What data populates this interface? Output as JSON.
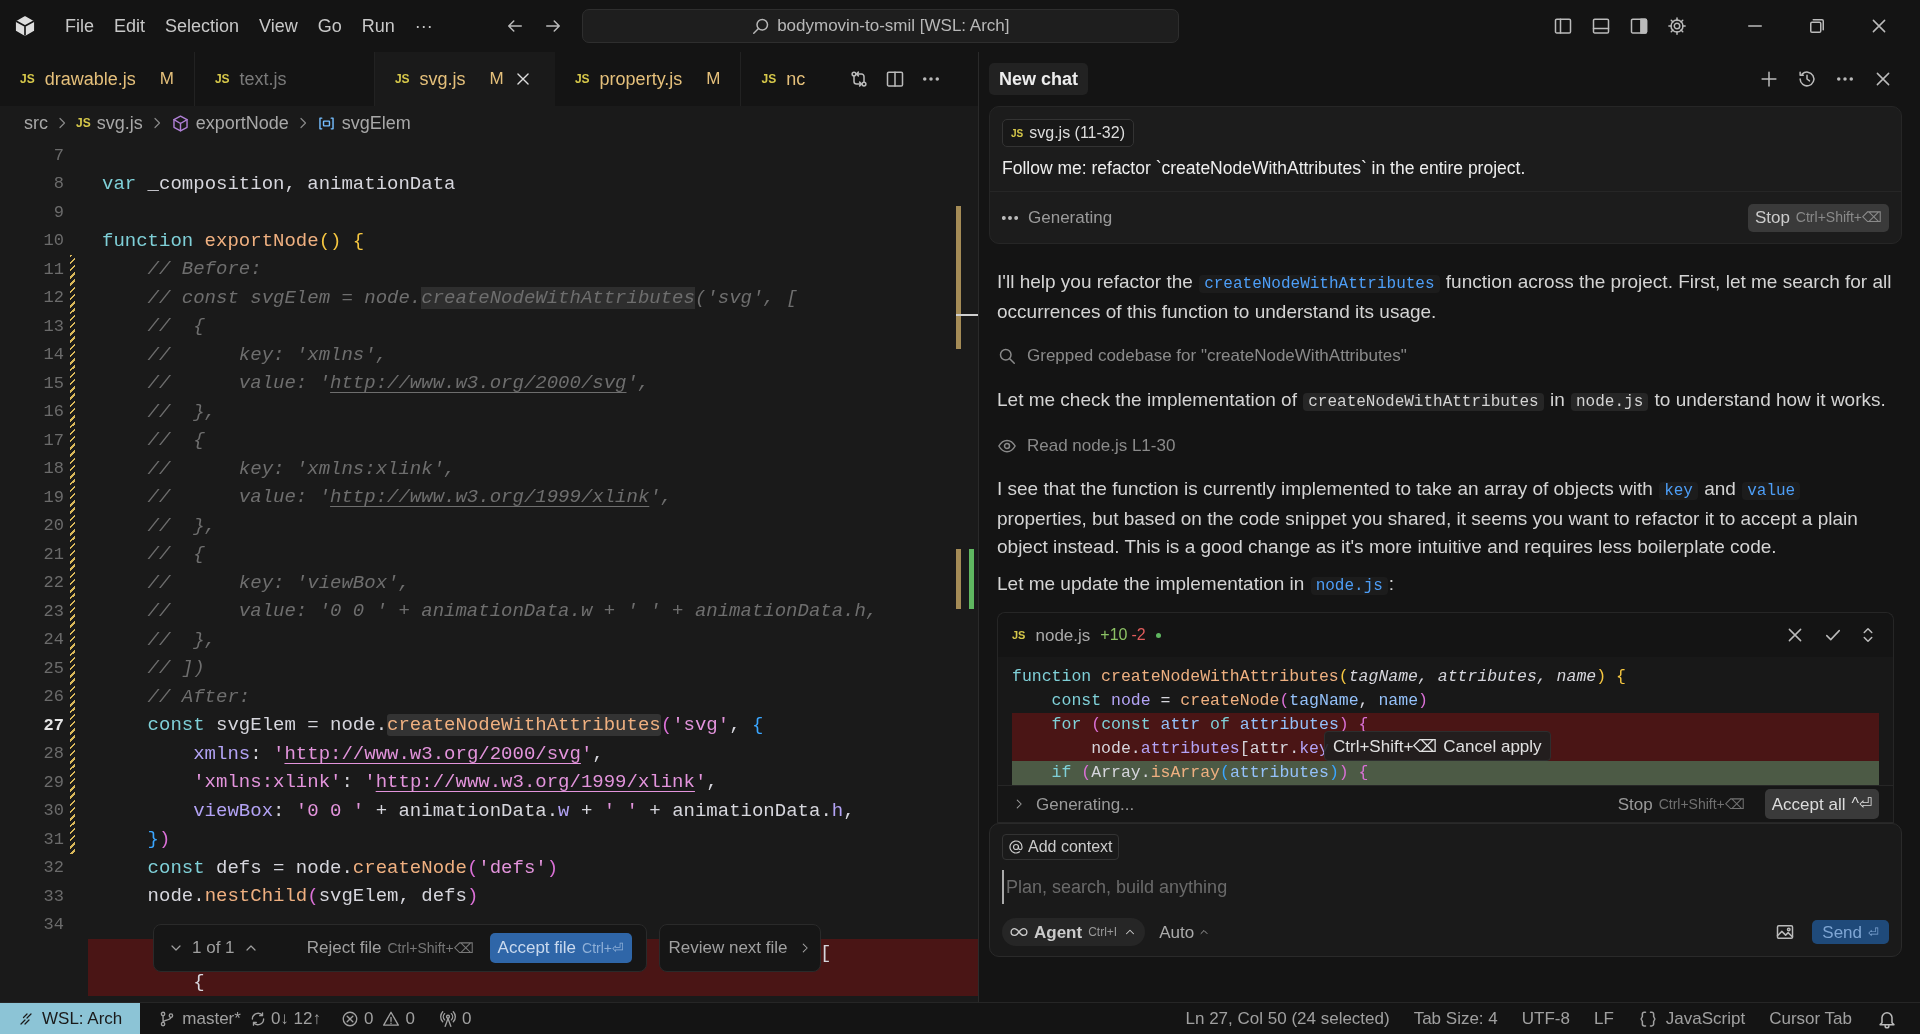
{
  "title_bar": {
    "menu": [
      "File",
      "Edit",
      "Selection",
      "View",
      "Go",
      "Run",
      "···"
    ],
    "search": "bodymovin-to-smil [WSL: Arch]"
  },
  "editor_tabs": [
    {
      "file_icon": "JS",
      "label": "drawable.js",
      "badge": "M",
      "kind": "modified",
      "selected": false
    },
    {
      "file_icon": "JS",
      "label": "text.js",
      "kind": "preview",
      "selected": false
    },
    {
      "file_icon": "JS",
      "label": "svg.js",
      "badge": "M",
      "kind": "modified",
      "selected": true
    },
    {
      "file_icon": "JS",
      "label": "property.js",
      "badge": "M",
      "kind": "modified",
      "selected": false
    },
    {
      "file_icon": "JS",
      "label": "nc",
      "kind": "modified",
      "selected": false
    }
  ],
  "breadcrumb": [
    {
      "kind": "folder",
      "label": "src"
    },
    {
      "kind": "file",
      "file_icon": "JS",
      "label": "svg.js"
    },
    {
      "kind": "method",
      "label": "exportNode"
    },
    {
      "kind": "variable",
      "label": "svgElem"
    }
  ],
  "code": [
    {
      "kind": "line",
      "n": "7",
      "changed": false,
      "current": false
    },
    {
      "kind": "line",
      "n": "8",
      "changed": false,
      "current": false,
      "tokens": [
        {
          "t": "var",
          "kind": "kw"
        },
        {
          "t": " _composition, animationData",
          "kind": "plain"
        }
      ]
    },
    {
      "kind": "line",
      "n": "9",
      "changed": false,
      "current": false
    },
    {
      "kind": "line",
      "n": "10",
      "changed": false,
      "current": false,
      "tokens": [
        {
          "t": "function",
          "kind": "kw"
        },
        {
          "t": " exportNode",
          "kind": "fn"
        },
        {
          "t": "()",
          "kind": "b1"
        },
        {
          "t": " {",
          "kind": "b1"
        }
      ]
    },
    {
      "kind": "line",
      "n": "11",
      "changed": true,
      "current": false,
      "tokens": [
        {
          "t": "    // Before:",
          "kind": "cmt"
        }
      ]
    },
    {
      "kind": "line",
      "n": "12",
      "changed": true,
      "current": false,
      "tokens": [
        {
          "t": "    // const svgElem = node.",
          "kind": "cmt"
        },
        {
          "t": "createNodeWithAttributes",
          "kind": "cmt-hl"
        },
        {
          "t": "('svg', [",
          "kind": "cmt"
        }
      ]
    },
    {
      "kind": "line",
      "n": "13",
      "changed": true,
      "current": false,
      "tokens": [
        {
          "t": "    //  {",
          "kind": "cmt"
        }
      ]
    },
    {
      "kind": "line",
      "n": "14",
      "changed": true,
      "current": false,
      "tokens": [
        {
          "t": "    //      key: 'xmlns',",
          "kind": "cmt"
        }
      ]
    },
    {
      "kind": "line",
      "n": "15",
      "changed": true,
      "current": false,
      "tokens": [
        {
          "t": "    //      value: '",
          "kind": "cmt"
        },
        {
          "t": "http://www.w3.org/2000/svg",
          "kind": "cmt-url"
        },
        {
          "t": "',",
          "kind": "cmt"
        }
      ]
    },
    {
      "kind": "line",
      "n": "16",
      "changed": true,
      "current": false,
      "tokens": [
        {
          "t": "    //  },",
          "kind": "cmt"
        }
      ]
    },
    {
      "kind": "line",
      "n": "17",
      "changed": true,
      "current": false,
      "tokens": [
        {
          "t": "    //  {",
          "kind": "cmt"
        }
      ]
    },
    {
      "kind": "line",
      "n": "18",
      "changed": true,
      "current": false,
      "tokens": [
        {
          "t": "    //      key: 'xmlns:xlink',",
          "kind": "cmt"
        }
      ]
    },
    {
      "kind": "line",
      "n": "19",
      "changed": true,
      "current": false,
      "tokens": [
        {
          "t": "    //      value: '",
          "kind": "cmt"
        },
        {
          "t": "http://www.w3.org/1999/xlink",
          "kind": "cmt-url"
        },
        {
          "t": "',",
          "kind": "cmt"
        }
      ]
    },
    {
      "kind": "line",
      "n": "20",
      "changed": true,
      "current": false,
      "tokens": [
        {
          "t": "    //  },",
          "kind": "cmt"
        }
      ]
    },
    {
      "kind": "line",
      "n": "21",
      "changed": true,
      "current": false,
      "tokens": [
        {
          "t": "    //  {",
          "kind": "cmt"
        }
      ]
    },
    {
      "kind": "line",
      "n": "22",
      "changed": true,
      "current": false,
      "tokens": [
        {
          "t": "    //      key: 'viewBox',",
          "kind": "cmt"
        }
      ]
    },
    {
      "kind": "line",
      "n": "23",
      "changed": true,
      "current": false,
      "tokens": [
        {
          "t": "    //      value: '0 0 ' + animationData.w + ' ' + animationData.h,",
          "kind": "cmt"
        }
      ]
    },
    {
      "kind": "line",
      "n": "24",
      "changed": true,
      "current": false,
      "tokens": [
        {
          "t": "    //  },",
          "kind": "cmt"
        }
      ]
    },
    {
      "kind": "line",
      "n": "25",
      "changed": true,
      "current": false,
      "tokens": [
        {
          "t": "    // ])",
          "kind": "cmt"
        }
      ]
    },
    {
      "kind": "line",
      "n": "26",
      "changed": true,
      "current": false,
      "tokens": [
        {
          "t": "    // After:",
          "kind": "cmt"
        }
      ]
    },
    {
      "kind": "line",
      "n": "27",
      "changed": true,
      "current": true,
      "tokens": [
        {
          "t": "    const",
          "kind": "kw"
        },
        {
          "t": " svgElem = node.",
          "kind": "plain"
        },
        {
          "t": "createNodeWithAttributes",
          "kind": "fn-hl"
        },
        {
          "t": "(",
          "kind": "b2"
        },
        {
          "t": "'svg'",
          "kind": "str"
        },
        {
          "t": ",",
          "kind": "plain"
        },
        {
          "t": " {",
          "kind": "b3"
        }
      ]
    },
    {
      "kind": "line",
      "n": "28",
      "changed": true,
      "current": false,
      "tokens": [
        {
          "t": "        xmlns",
          "kind": "prop"
        },
        {
          "t": ": ",
          "kind": "plain"
        },
        {
          "t": "'",
          "kind": "str"
        },
        {
          "t": "http://www.w3.org/2000/svg",
          "kind": "str-url"
        },
        {
          "t": "'",
          "kind": "str"
        },
        {
          "t": ",",
          "kind": "plain"
        }
      ]
    },
    {
      "kind": "line",
      "n": "29",
      "changed": true,
      "current": false,
      "tokens": [
        {
          "t": "        'xmlns:xlink'",
          "kind": "str"
        },
        {
          "t": ": ",
          "kind": "plain"
        },
        {
          "t": "'",
          "kind": "str"
        },
        {
          "t": "http://www.w3.org/1999/xlink",
          "kind": "str-url"
        },
        {
          "t": "'",
          "kind": "str"
        },
        {
          "t": ",",
          "kind": "plain"
        }
      ]
    },
    {
      "kind": "line",
      "n": "30",
      "changed": true,
      "current": false,
      "tokens": [
        {
          "t": "        viewBox",
          "kind": "prop"
        },
        {
          "t": ": ",
          "kind": "plain"
        },
        {
          "t": "'0 0 '",
          "kind": "str"
        },
        {
          "t": " + animationData.",
          "kind": "plain"
        },
        {
          "t": "w",
          "kind": "prop"
        },
        {
          "t": " + ",
          "kind": "plain"
        },
        {
          "t": "' '",
          "kind": "str"
        },
        {
          "t": " + animationData.",
          "kind": "plain"
        },
        {
          "t": "h",
          "kind": "prop"
        },
        {
          "t": ",",
          "kind": "plain"
        }
      ]
    },
    {
      "kind": "line",
      "n": "31",
      "changed": true,
      "current": false,
      "tokens": [
        {
          "t": "    }",
          "kind": "b3"
        },
        {
          "t": ")",
          "kind": "b2"
        }
      ]
    },
    {
      "kind": "line",
      "n": "32",
      "changed": false,
      "current": false,
      "tokens": [
        {
          "t": "    const",
          "kind": "kw"
        },
        {
          "t": " defs = node.",
          "kind": "plain"
        },
        {
          "t": "createNode",
          "kind": "fn"
        },
        {
          "t": "(",
          "kind": "b2"
        },
        {
          "t": "'defs'",
          "kind": "str"
        },
        {
          "t": ")",
          "kind": "b2"
        }
      ]
    },
    {
      "kind": "line",
      "n": "33",
      "changed": false,
      "current": false,
      "tokens": [
        {
          "t": "    node.",
          "kind": "plain"
        },
        {
          "t": "nestChild",
          "kind": "fn"
        },
        {
          "t": "(",
          "kind": "b2"
        },
        {
          "t": "svgElem, defs",
          "kind": "plain"
        },
        {
          "t": ")",
          "kind": "b2"
        }
      ]
    },
    {
      "kind": "line",
      "n": "34",
      "changed": false,
      "current": false
    },
    {
      "kind": "deleted-tail",
      "tokens": [
        {
          "t": "[",
          "kind": "plain"
        }
      ]
    },
    {
      "kind": "deleted",
      "tokens": [
        {
          "t": "        {",
          "kind": "plain"
        }
      ]
    }
  ],
  "review_bar": {
    "counter": "1 of 1",
    "reject": {
      "label": "Reject file",
      "shortcut": "Ctrl+Shift+⌫"
    },
    "accept": {
      "label": "Accept file",
      "shortcut": "Ctrl+⏎"
    },
    "next": "Review next file"
  },
  "chat": {
    "title": "New chat",
    "prompt": {
      "chip": {
        "file_icon": "JS",
        "label": "svg.js (11-32)"
      },
      "text": "Follow me: refactor `createNodeWithAttributes` in the entire project.",
      "status": "Generating",
      "stop": {
        "label": "Stop",
        "shortcut": "Ctrl+Shift+⌫"
      }
    },
    "messages": [
      {
        "kind": "text",
        "segments": [
          {
            "t": "I'll help you refactor the ",
            "kind": "text"
          },
          {
            "t": "createNodeWithAttributes",
            "kind": "code-link"
          },
          {
            "t": " function across the project. First, let me search for all occurrences of this function to understand its usage.",
            "kind": "text"
          }
        ]
      },
      {
        "kind": "search-tool",
        "label": "Grepped codebase for \"createNodeWithAttributes\""
      },
      {
        "kind": "text",
        "segments": [
          {
            "t": "Let me check the implementation of ",
            "kind": "text"
          },
          {
            "t": "createNodeWithAttributes",
            "kind": "code"
          },
          {
            "t": " in ",
            "kind": "text"
          },
          {
            "t": "node.js",
            "kind": "code"
          },
          {
            "t": " to understand how it works.",
            "kind": "text"
          }
        ]
      },
      {
        "kind": "read-tool",
        "label": "Read node.js L1-30"
      },
      {
        "kind": "text",
        "segments": [
          {
            "t": "I see that the function is currently implemented to take an array of objects with ",
            "kind": "text"
          },
          {
            "t": "key",
            "kind": "code-link"
          },
          {
            "t": " and ",
            "kind": "text"
          },
          {
            "t": "value",
            "kind": "code-link"
          },
          {
            "t": " properties, but based on the code snippet you shared, it seems you want to refactor it to accept a plain object instead. This is a good change as it's more intuitive and requires less boilerplate code.",
            "kind": "text"
          }
        ]
      },
      {
        "kind": "text",
        "segments": [
          {
            "t": "Let me update the implementation in ",
            "kind": "text"
          },
          {
            "t": "node.js",
            "kind": "code-link"
          },
          {
            "t": ":",
            "kind": "text"
          }
        ]
      }
    ],
    "diff": {
      "file_icon": "JS",
      "file": "node.js",
      "added": "+10",
      "removed": "-2",
      "lines": [
        {
          "kind": "normal",
          "tokens": [
            {
              "t": "function",
              "kind": "kw"
            },
            {
              "t": " createNodeWithAttributes",
              "kind": "fn"
            },
            {
              "t": "(",
              "kind": "b1"
            },
            {
              "t": "tagName, attributes, name",
              "kind": "param"
            },
            {
              "t": ")",
              "kind": "b1"
            },
            {
              "t": " {",
              "kind": "b1"
            }
          ]
        },
        {
          "kind": "normal",
          "tokens": [
            {
              "t": "    const",
              "kind": "kw"
            },
            {
              "t": " node",
              "kind": "prop"
            },
            {
              "t": " = ",
              "kind": "plain"
            },
            {
              "t": "createNode",
              "kind": "fn"
            },
            {
              "t": "(",
              "kind": "b2"
            },
            {
              "t": "tagName",
              "kind": "var"
            },
            {
              "t": ", ",
              "kind": "plain"
            },
            {
              "t": "name",
              "kind": "var"
            },
            {
              "t": ")",
              "kind": "b2"
            }
          ]
        },
        {
          "kind": "deleted",
          "tokens": [
            {
              "t": "    for",
              "kind": "kw"
            },
            {
              "t": " (",
              "kind": "b2"
            },
            {
              "t": "const",
              "kind": "kw"
            },
            {
              "t": " attr",
              "kind": "var"
            },
            {
              "t": " of",
              "kind": "kw"
            },
            {
              "t": " attributes",
              "kind": "var"
            },
            {
              "t": ")",
              "kind": "b2"
            },
            {
              "t": " {",
              "kind": "b2"
            }
          ]
        },
        {
          "kind": "deleted",
          "tokens": [
            {
              "t": "        node.",
              "kind": "plain"
            },
            {
              "t": "attributes",
              "kind": "prop"
            },
            {
              "t": "[attr.",
              "kind": "plain"
            },
            {
              "t": "key",
              "kind": "prop"
            }
          ]
        },
        {
          "kind": "added",
          "tokens": [
            {
              "t": "    if",
              "kind": "kw"
            },
            {
              "t": " (",
              "kind": "b2"
            },
            {
              "t": "Array.",
              "kind": "plain"
            },
            {
              "t": "isArray",
              "kind": "fn"
            },
            {
              "t": "(",
              "kind": "b3"
            },
            {
              "t": "attributes",
              "kind": "var"
            },
            {
              "t": ")",
              "kind": "b3"
            },
            {
              "t": ")",
              "kind": "b2"
            },
            {
              "t": " {",
              "kind": "b2"
            }
          ]
        }
      ],
      "tooltip": {
        "shortcut": "Ctrl+Shift+⌫",
        "label": "Cancel apply"
      }
    },
    "apply_bar": {
      "status": "Generating...",
      "stop": {
        "label": "Stop",
        "shortcut": "Ctrl+Shift+⌫"
      },
      "accept_all": {
        "label": "Accept all",
        "shortcut": "^⏎"
      }
    },
    "input": {
      "add_context": "Add context",
      "placeholder": "Plan, search, build anything",
      "mode": {
        "label": "Agent",
        "shortcut": "Ctrl+I"
      },
      "model": "Auto",
      "send": {
        "label": "Send",
        "shortcut": "⏎"
      }
    }
  },
  "status_bar": {
    "remote": "WSL: Arch",
    "branch": "master*",
    "sync": "0↓ 12↑",
    "errors": "0",
    "warnings": "0",
    "ports": "0",
    "right": [
      {
        "kind": "text",
        "label": "Ln 27, Col 50 (24 selected)"
      },
      {
        "kind": "text",
        "label": "Tab Size: 4"
      },
      {
        "kind": "text",
        "label": "UTF-8"
      },
      {
        "kind": "text",
        "label": "LF"
      },
      {
        "kind": "language",
        "label": "JavaScript"
      },
      {
        "kind": "text",
        "label": "Cursor Tab"
      }
    ]
  }
}
